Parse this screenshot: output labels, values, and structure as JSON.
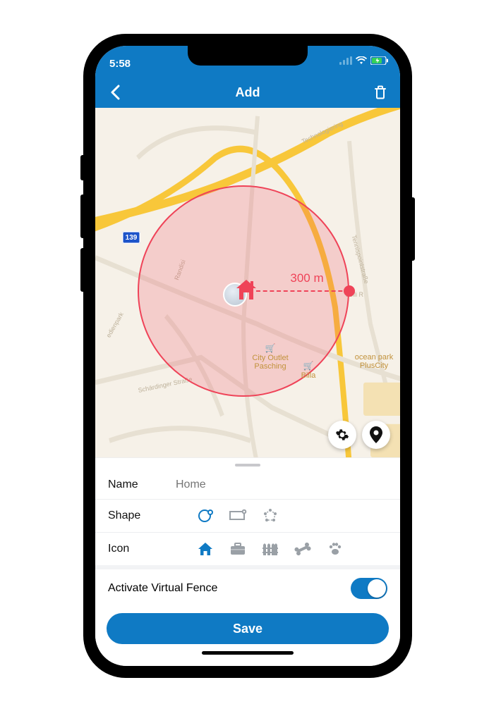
{
  "status": {
    "time": "5:58"
  },
  "nav": {
    "title": "Add"
  },
  "map": {
    "radius_label": "300 m",
    "road_shield": "139",
    "pois": {
      "city_outlet": "City Outlet\nPasching",
      "billa": "Billa",
      "ocean_park": "ocean park\nPlusCity"
    },
    "streets": {
      "randisi": "Randisi",
      "technologiering": "Technologiering",
      "schaerdinger": "Schärdinger Straße",
      "edienpark": "edienpark",
      "tennispoint": "Tennispointstraße",
      "loll": "Lolli R"
    }
  },
  "form": {
    "name_label": "Name",
    "name_placeholder": "Home",
    "shape_label": "Shape",
    "icon_label": "Icon",
    "activate_label": "Activate Virtual Fence",
    "save_label": "Save"
  }
}
